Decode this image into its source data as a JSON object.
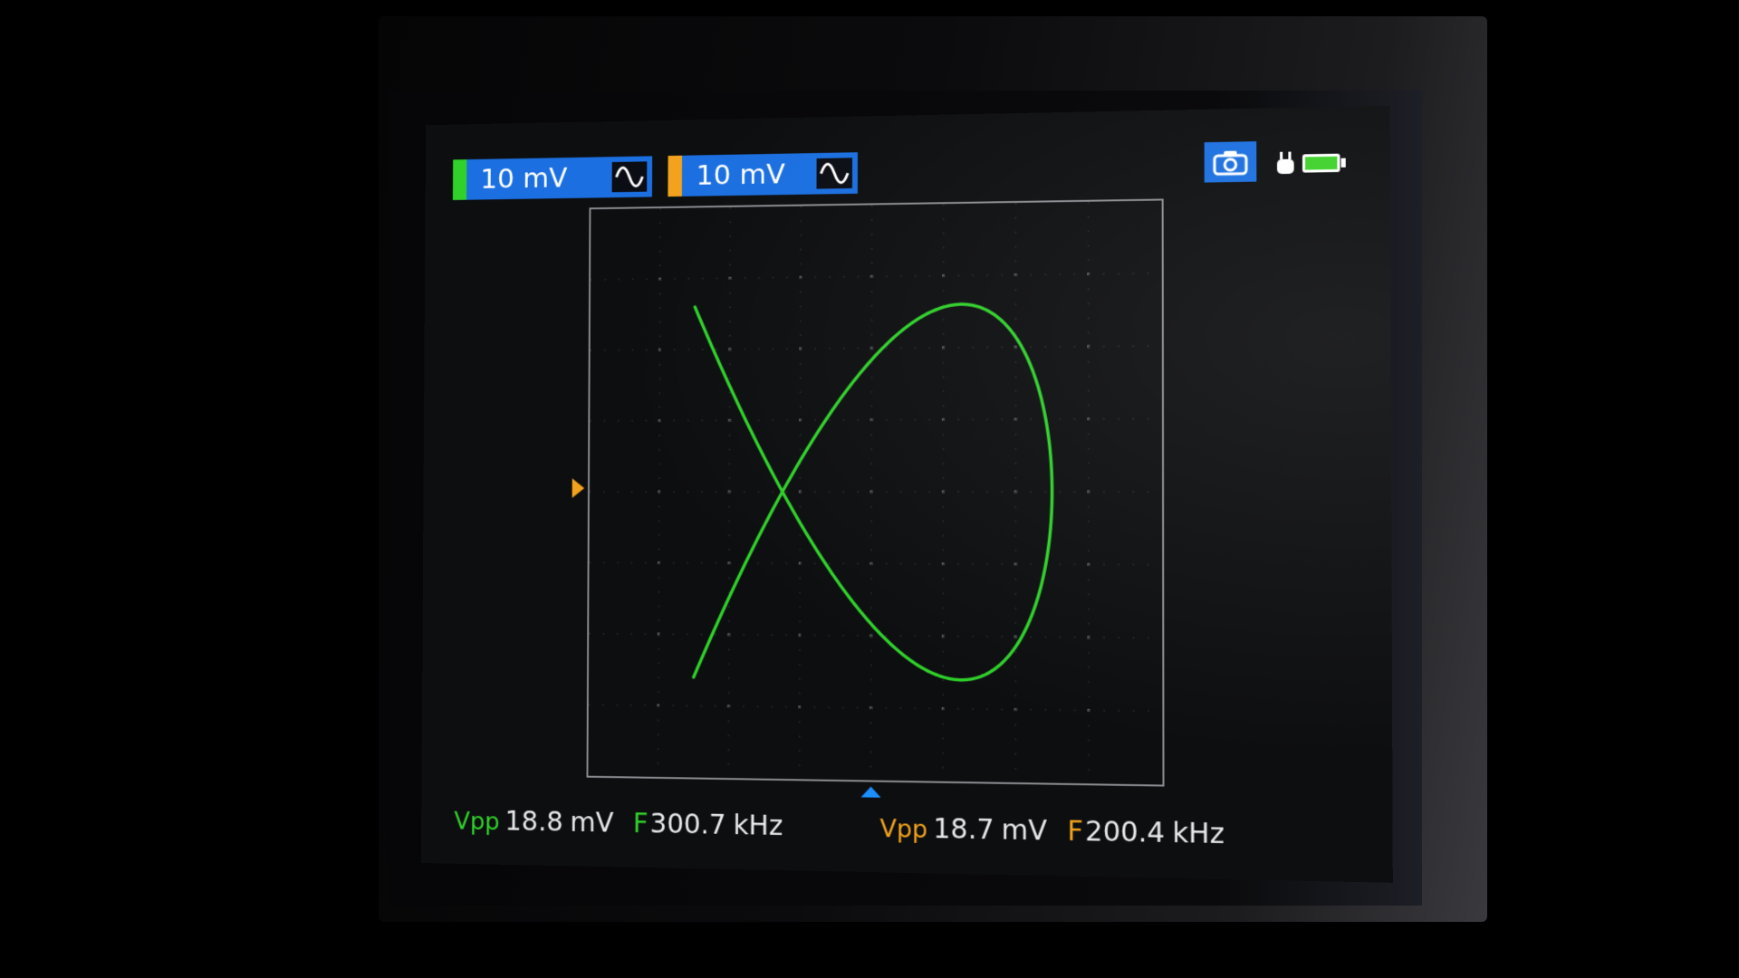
{
  "channels": [
    {
      "scale": "10 mV",
      "coupling_icon": "sine-wave-icon",
      "color": "#2fd12a"
    },
    {
      "scale": "10 mV",
      "coupling_icon": "sine-wave-icon",
      "color": "#f2a21c"
    }
  ],
  "status_icons": [
    "camera-icon",
    "plug-icon",
    "battery-icon"
  ],
  "measurements": [
    {
      "vpp_label": "Vpp",
      "vpp_value": "18.8",
      "vpp_unit": "mV",
      "f_label": "F",
      "f_value": "300.7",
      "f_unit": "kHz",
      "color": "#2fd12a"
    },
    {
      "vpp_label": "Vpp",
      "vpp_value": "18.7",
      "vpp_unit": "mV",
      "f_label": "F",
      "f_value": "200.4",
      "f_unit": "kHz",
      "color": "#f2a21c"
    }
  ],
  "chart_data": {
    "type": "xy",
    "trace_color": "#2fd12a",
    "grid": true,
    "grid_divisions": [
      8,
      8
    ],
    "series": [
      {
        "x_frequency_ratio": 2,
        "y_frequency_ratio": 3,
        "phase_deg": 90,
        "x_amplitude_div": 2.5,
        "y_amplitude_div": 2.6
      }
    ]
  },
  "colors": {
    "accent": "#1b6fe0",
    "trace": "#2fd12a",
    "ch2": "#f2a21c"
  }
}
